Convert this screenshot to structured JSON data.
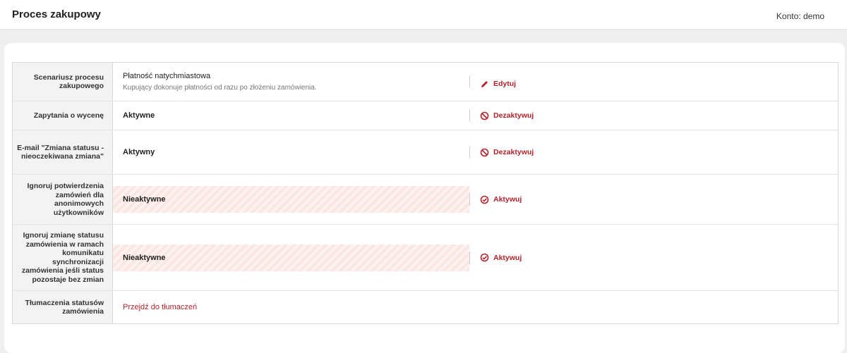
{
  "header": {
    "title": "Proces zakupowy",
    "account_label": "Konto:",
    "account_value": "demo"
  },
  "rows": [
    {
      "label": "Scenariusz procesu zakupowego",
      "value": "Płatność natychmiastowa",
      "description": "Kupujący dokonuje płatności od razu po złożeniu zamówienia.",
      "action": "Edytuj",
      "action_icon": "pencil-icon"
    },
    {
      "label": "Zapytania o wycenę",
      "value": "Aktywne",
      "action": "Dezaktywuj",
      "action_icon": "prohibited-icon"
    },
    {
      "label": "E-mail \"Zmiana statusu - nieoczekiwana zmiana\"",
      "value": "Aktywny",
      "action": "Dezaktywuj",
      "action_icon": "prohibited-icon"
    },
    {
      "label": "Ignoruj potwierdzenia zamówień dla anonimowych użytkowników",
      "value": "Nieaktywne",
      "action": "Aktywuj",
      "action_icon": "check-circle-icon"
    },
    {
      "label": "Ignoruj zmianę statusu zamówienia w ramach komunikatu synchronizacji zamówienia jeśli status pozostaje bez zmian",
      "value": "Nieaktywne",
      "action": "Aktywuj",
      "action_icon": "check-circle-icon"
    },
    {
      "label": "Tłumaczenia statusów zamówienia",
      "link": "Przejdź do tłumaczeń"
    }
  ],
  "colors": {
    "accent": "#b3222a",
    "inactive_bg": "#fbe7e1"
  }
}
